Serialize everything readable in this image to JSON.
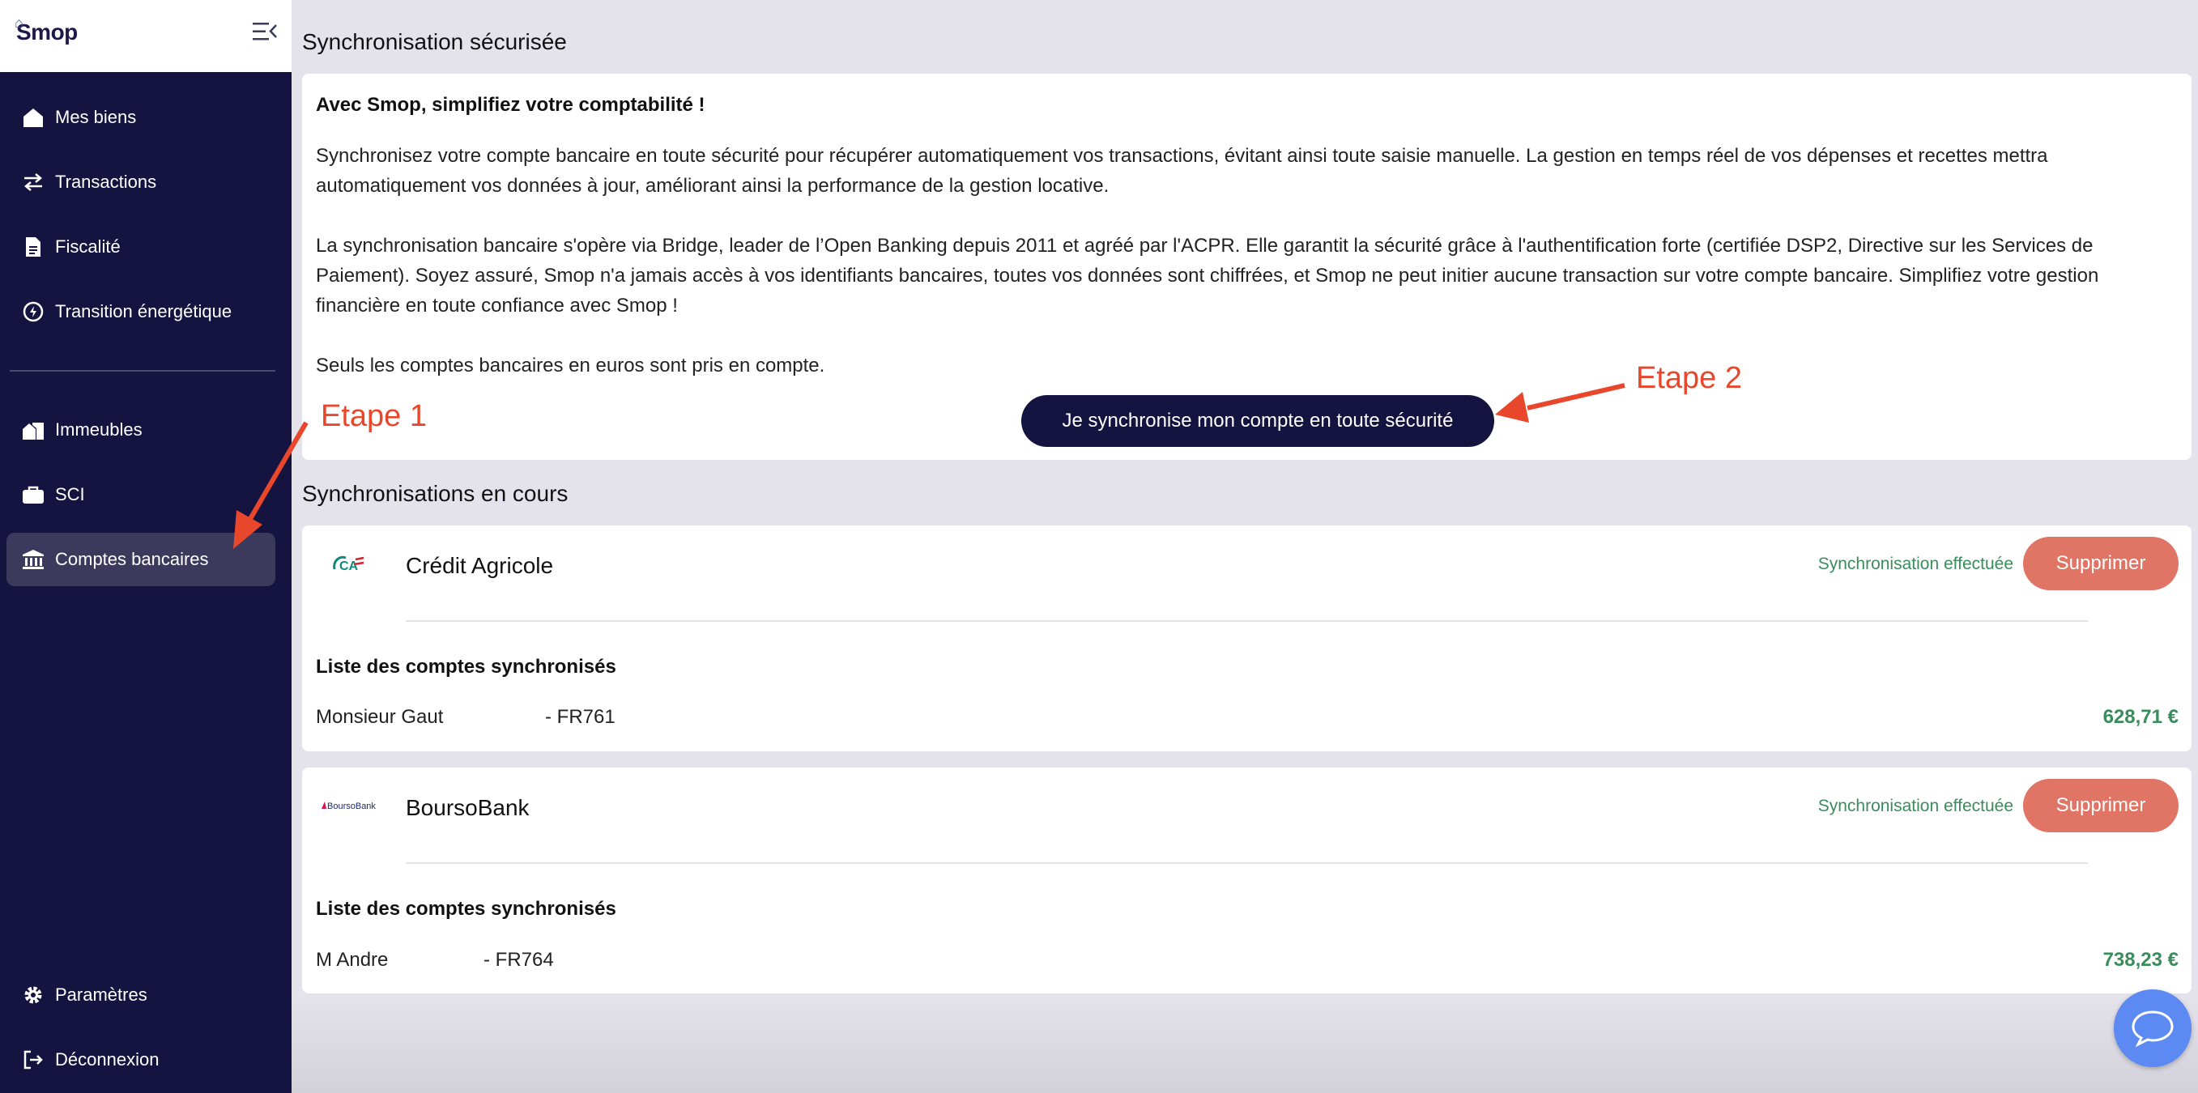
{
  "sidebar": {
    "logo": "Smop",
    "items": [
      {
        "label": "Mes biens",
        "icon": "home-icon"
      },
      {
        "label": "Transactions",
        "icon": "swap-arrows-icon"
      },
      {
        "label": "Fiscalité",
        "icon": "document-icon"
      },
      {
        "label": "Transition énergétique",
        "icon": "energy-icon"
      },
      {
        "label": "Immeubles",
        "icon": "buildings-icon"
      },
      {
        "label": "SCI",
        "icon": "briefcase-icon"
      },
      {
        "label": "Comptes bancaires",
        "icon": "bank-icon",
        "active": true
      }
    ],
    "footer": [
      {
        "label": "Paramètres",
        "icon": "gear-icon"
      },
      {
        "label": "Déconnexion",
        "icon": "logout-icon"
      }
    ]
  },
  "main": {
    "section1_title": "Synchronisation sécurisée",
    "intro": {
      "headline": "Avec Smop, simplifiez votre comptabilité !",
      "p1": "Synchronisez votre compte bancaire en toute sécurité pour récupérer automatiquement vos transactions, évitant ainsi toute saisie manuelle. La gestion en temps réel de vos dépenses et recettes mettra automatiquement vos données à jour, améliorant ainsi la performance de la gestion locative.",
      "p2": "La synchronisation bancaire s'opère via Bridge, leader de l’Open Banking depuis 2011 et agréé par l'ACPR. Elle garantit la sécurité grâce à l'authentification forte (certifiée DSP2, Directive sur les Services de Paiement). Soyez assuré, Smop n'a jamais accès à vos identifiants bancaires, toutes vos données sont chiffrées, et Smop ne peut initier aucune transaction sur votre compte bancaire. Simplifiez votre gestion financière en toute confiance avec Smop !",
      "p3": "Seuls les comptes bancaires en euros sont pris en compte.",
      "button": "Je synchronise mon compte en toute sécurité"
    },
    "section2_title": "Synchronisations en cours",
    "banks": [
      {
        "logo_text": "CA",
        "name": "Crédit Agricole",
        "status": "Synchronisation effectuée",
        "delete": "Supprimer",
        "list_title": "Liste des comptes synchronisés",
        "account": {
          "holder": "Monsieur Gaut",
          "iban": "- FR761",
          "balance": "628,71 €"
        }
      },
      {
        "logo_text": "BoursoBank",
        "name": "BoursoBank",
        "status": "Synchronisation effectuée",
        "delete": "Supprimer",
        "list_title": "Liste des comptes synchronisés",
        "account": {
          "holder": "M Andre",
          "iban": "- FR764",
          "balance": "738,23 €"
        }
      }
    ]
  },
  "annotations": {
    "step1": "Etape 1",
    "step2": "Etape 2"
  },
  "colors": {
    "sidebar": "#15133f",
    "active": "#3b3a5c",
    "accent_red": "#e8472b",
    "delete": "#e07565",
    "success": "#3a8c5c",
    "chat": "#5c8af2"
  }
}
